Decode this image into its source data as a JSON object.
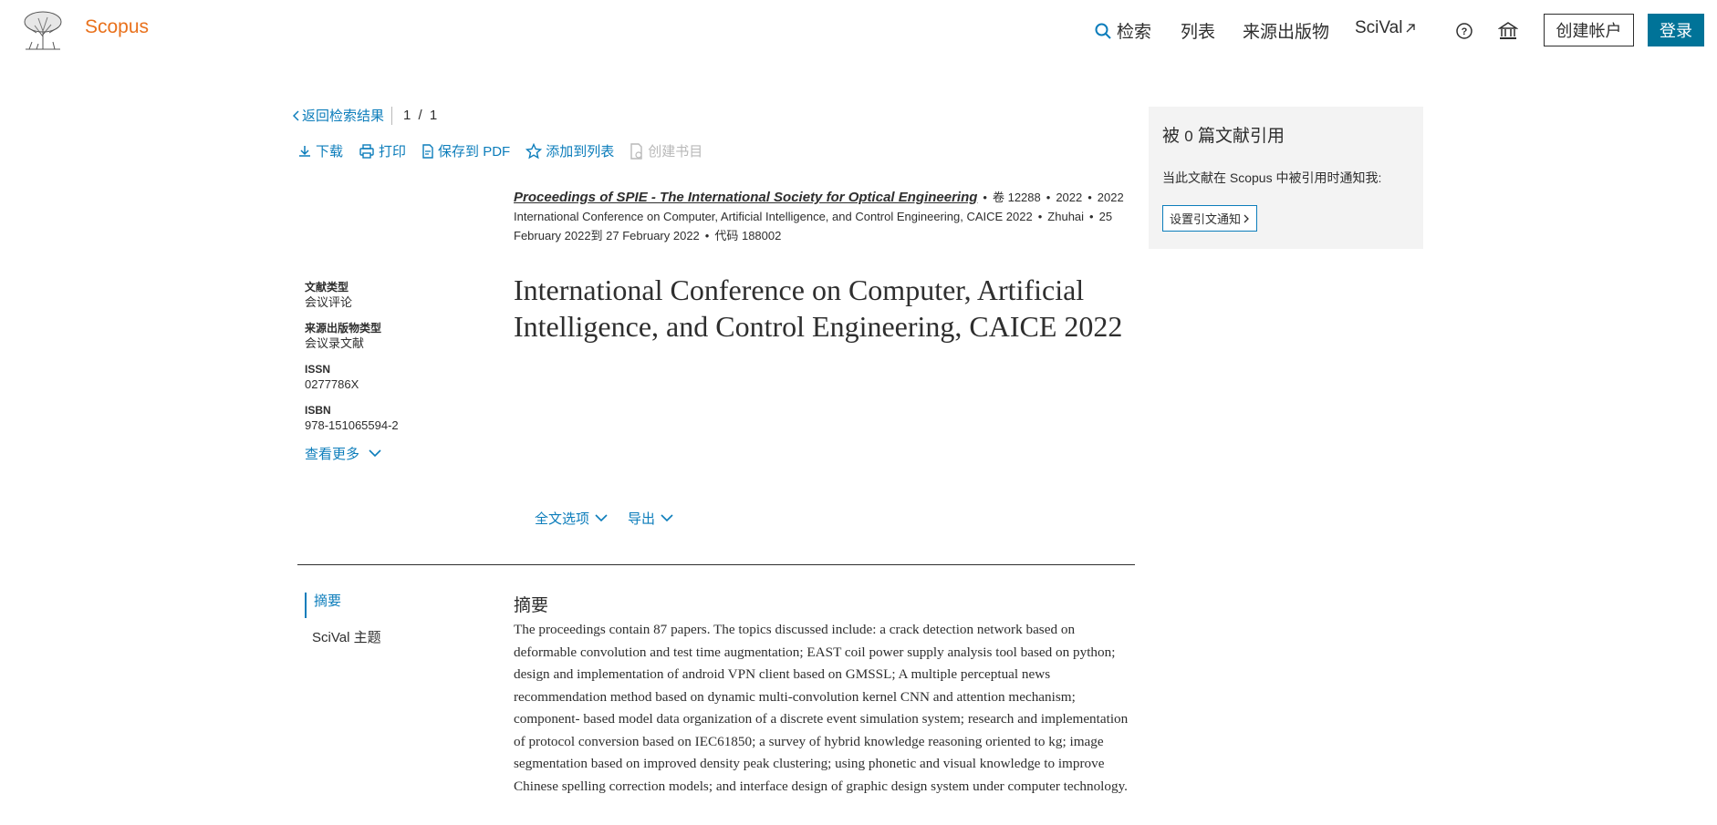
{
  "header": {
    "brand": "Scopus",
    "nav": {
      "search": "检索",
      "lists": "列表",
      "sources": "来源出版物",
      "scival": "SciVal"
    },
    "create_account": "创建帐户",
    "login": "登录",
    "icons": [
      "search-icon",
      "help-icon",
      "institution-icon",
      "external-link-icon"
    ],
    "accent_color": "#007398",
    "brand_color": "#e9711c"
  },
  "back": {
    "label": "返回检索结果",
    "pager": "1 / 1"
  },
  "toolbar": {
    "download": "下载",
    "print": "打印",
    "save_pdf": "保存到 PDF",
    "add_list": "添加到列表",
    "create_bib": "创建书目"
  },
  "source": {
    "title": "Proceedings of SPIE - The International Society for Optical Engineering",
    "volume": "卷 12288",
    "year1": "2022",
    "year2": "2022",
    "conference": "International Conference on Computer, Artificial Intelligence, and Control Engineering, CAICE 2022",
    "location": "Zhuhai",
    "dates": "25 February 2022到 27 February 2022",
    "code": "代码 188002"
  },
  "meta": {
    "doc_type_label": "文献类型",
    "doc_type": "会议评论",
    "source_type_label": "来源出版物类型",
    "source_type": "会议录文献",
    "issn_label": "ISSN",
    "issn": "0277786X",
    "isbn_label": "ISBN",
    "isbn": "978-151065594-2",
    "see_more": "查看更多"
  },
  "document": {
    "title": "International Conference on Computer, Artificial Intelligence, and Control Engineering, CAICE 2022"
  },
  "options": {
    "full_text": "全文选项",
    "export": "导出"
  },
  "sidenav": {
    "abstract": "摘要",
    "scival_topics": "SciVal 主题"
  },
  "abstract": {
    "heading": "摘要",
    "text": "The proceedings contain 87 papers. The topics discussed include: a crack detection network based on deformable convolution and test time augmentation; EAST coil power supply analysis tool based on python; design and implementation of android VPN client based on GMSSL; A multiple perceptual news recommendation method based on dynamic multi-convolution kernel CNN and attention mechanism; component- based model data organization of a discrete event simulation system; research and implementation of protocol conversion based on IEC61850; a survey of hybrid knowledge reasoning oriented to kg; image segmentation based on improved density peak clustering; using phonetic and visual knowledge to improve Chinese spelling correction models; and interface design of graphic design system under computer technology."
  },
  "citations": {
    "prefix": "被",
    "count": "0",
    "suffix": "篇文献引用",
    "note": "当此文献在 Scopus 中被引用时通知我:",
    "button": "设置引文通知"
  }
}
